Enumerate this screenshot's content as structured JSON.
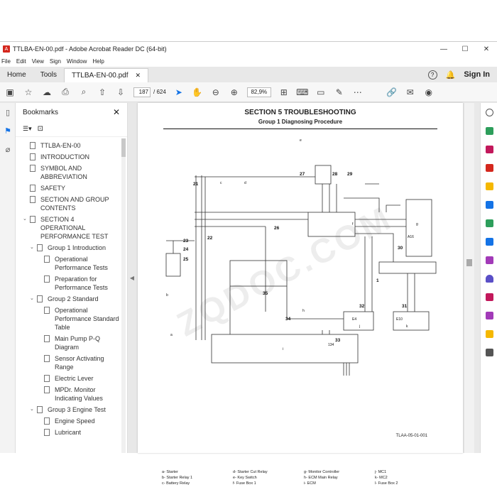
{
  "window": {
    "title": "TTLBA-EN-00.pdf - Adobe Acrobat Reader DC (64-bit)"
  },
  "menu": [
    "File",
    "Edit",
    "View",
    "Sign",
    "Window",
    "Help"
  ],
  "tabs": {
    "home": "Home",
    "tools": "Tools",
    "document": "TTLBA-EN-00.pdf",
    "signin": "Sign In"
  },
  "toolbar": {
    "page_current": "187",
    "page_total": "/ 624",
    "zoom": "82,9%"
  },
  "bookmarks": {
    "title": "Bookmarks",
    "items": [
      {
        "label": "TTLBA-EN-00",
        "indent": 0,
        "expander": ""
      },
      {
        "label": "INTRODUCTION",
        "indent": 0,
        "expander": ""
      },
      {
        "label": "SYMBOL AND ABBREVIATION",
        "indent": 0,
        "expander": ""
      },
      {
        "label": "SAFETY",
        "indent": 0,
        "expander": ""
      },
      {
        "label": "SECTION AND GROUP CONTENTS",
        "indent": 0,
        "expander": ""
      },
      {
        "label": "SECTION 4 OPERATIONAL PERFORMANCE TEST",
        "indent": 0,
        "expander": "v"
      },
      {
        "label": "Group 1 Introduction",
        "indent": 1,
        "expander": "v"
      },
      {
        "label": "Operational Performance Tests",
        "indent": 2,
        "expander": ""
      },
      {
        "label": "Preparation for Performance Tests",
        "indent": 2,
        "expander": ""
      },
      {
        "label": "Group 2 Standard",
        "indent": 1,
        "expander": "v"
      },
      {
        "label": "Operational Performance Standard Table",
        "indent": 2,
        "expander": ""
      },
      {
        "label": "Main Pump P-Q Diagram",
        "indent": 2,
        "expander": ""
      },
      {
        "label": "Sensor Activating Range",
        "indent": 2,
        "expander": ""
      },
      {
        "label": "Electric Lever",
        "indent": 2,
        "expander": ""
      },
      {
        "label": "MPDr. Monitor Indicating Values",
        "indent": 2,
        "expander": ""
      },
      {
        "label": "Group 3 Engine Test",
        "indent": 1,
        "expander": "v"
      },
      {
        "label": "Engine Speed",
        "indent": 2,
        "expander": ""
      },
      {
        "label": "Lubricant",
        "indent": 2,
        "expander": ""
      }
    ]
  },
  "page": {
    "title": "SECTION 5 TROUBLESHOOTING",
    "subtitle": "Group 1 Diagnosing Procedure",
    "figure_code": "TLAA-05-01-001",
    "watermark": "ZQDOC.COM",
    "callouts": [
      "21",
      "22",
      "23",
      "24",
      "25",
      "26",
      "27",
      "28",
      "29",
      "30",
      "31",
      "32",
      "33",
      "34",
      "35",
      "1",
      "A16",
      "134",
      "E4",
      "E10"
    ],
    "letters": [
      "a",
      "b",
      "c",
      "d",
      "e",
      "f",
      "g",
      "h",
      "i",
      "j",
      "k"
    ],
    "legend": [
      "a-  Starter",
      "d-  Starter Cut Relay",
      "g-  Monitor Controller",
      "j-  MC1",
      "b-  Starter Relay 1",
      "e-  Key Switch",
      "h-  ECM Main Relay",
      "k-  MC2",
      "c-  Battery Relay",
      "f-  Fuse Box 1",
      "i-  ECM",
      "l-  Fuse Box 2"
    ]
  },
  "colors": {
    "accent": "#1473e6",
    "pdf_red": "#d4271d"
  }
}
